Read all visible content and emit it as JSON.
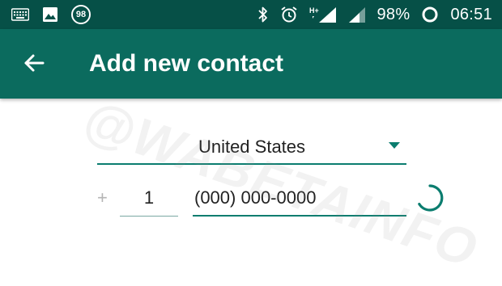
{
  "status_bar": {
    "notification_badge": "98",
    "battery_percent": "98%",
    "time": "06:51",
    "network_label": "H+",
    "icons_left": [
      "keyboard-icon",
      "image-icon",
      "notification-count-badge"
    ],
    "icons_right": [
      "bluetooth-icon",
      "alarm-icon",
      "signal-icon",
      "signal-icon",
      "battery-icon"
    ]
  },
  "app_bar": {
    "title": "Add new contact",
    "back_icon": "back-arrow-icon"
  },
  "form": {
    "country": "United States",
    "plus_sign": "+",
    "country_code": "1",
    "phone_placeholder": "(000) 000-0000"
  },
  "watermark": {
    "text": "@WABETAINFO"
  },
  "colors": {
    "status_bar": "#065047",
    "app_bar": "#0b6b5e",
    "accent": "#0b7d6f",
    "background": "#ffffff"
  }
}
